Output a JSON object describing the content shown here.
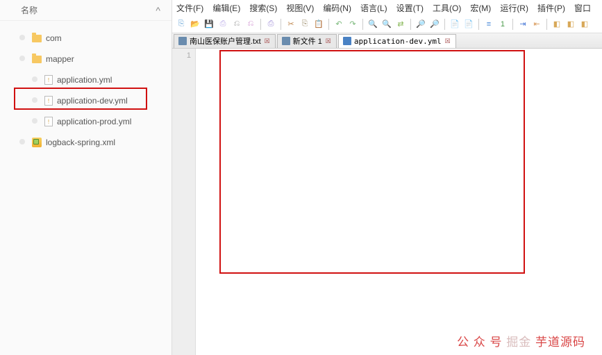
{
  "sidebar": {
    "header": {
      "name_col": "名称",
      "chev": "^"
    },
    "items": [
      {
        "label": "com",
        "icon": "folder",
        "indent": 1
      },
      {
        "label": "mapper",
        "icon": "folder",
        "indent": 1
      },
      {
        "label": "application.yml",
        "icon": "file",
        "indent": 2,
        "glyph": "!"
      },
      {
        "label": "application-dev.yml",
        "icon": "file",
        "indent": 2,
        "glyph": "!",
        "selected": true
      },
      {
        "label": "application-prod.yml",
        "icon": "file",
        "indent": 2,
        "glyph": "!"
      },
      {
        "label": "logback-spring.xml",
        "icon": "xml",
        "indent": 1
      }
    ]
  },
  "menu": {
    "items": [
      "文件(F)",
      "编辑(E)",
      "搜索(S)",
      "视图(V)",
      "编码(N)",
      "语言(L)",
      "设置(T)",
      "工具(O)",
      "宏(M)",
      "运行(R)",
      "插件(P)",
      "窗口"
    ]
  },
  "toolbar": {
    "groups": [
      [
        {
          "c": "#6aa6d8",
          "g": "⎘"
        },
        {
          "c": "#d8d058",
          "g": "📂"
        },
        {
          "c": "#7a7ae8",
          "g": "💾"
        },
        {
          "c": "#b8a8e8",
          "g": "⎙"
        },
        {
          "c": "#a0a0a0",
          "g": "⎌"
        },
        {
          "c": "#d090d0",
          "g": "⎌"
        }
      ],
      [
        {
          "c": "#a090d8",
          "g": "⎙"
        }
      ],
      [
        {
          "c": "#c08850",
          "g": "✂"
        },
        {
          "c": "#a09070",
          "g": "⎘"
        },
        {
          "c": "#a09070",
          "g": "📋"
        }
      ],
      [
        {
          "c": "#7ab87a",
          "g": "↶"
        },
        {
          "c": "#7ab87a",
          "g": "↷"
        }
      ],
      [
        {
          "c": "#6aa6d8",
          "g": "🔍"
        },
        {
          "c": "#88b858",
          "g": "🔍"
        },
        {
          "c": "#88b858",
          "g": "⇄"
        }
      ],
      [
        {
          "c": "#8a9ac8",
          "g": "🔎"
        },
        {
          "c": "#8a9ac8",
          "g": "🔎"
        }
      ],
      [
        {
          "c": "#e0a850",
          "g": "📄"
        },
        {
          "c": "#e0a850",
          "g": "📄"
        }
      ],
      [
        {
          "c": "#4a8ad8",
          "g": "≡"
        },
        {
          "c": "#4a9a4a",
          "g": "1"
        }
      ],
      [
        {
          "c": "#4a7ad8",
          "g": "⇥"
        },
        {
          "c": "#d89858",
          "g": "⇤"
        }
      ],
      [
        {
          "c": "#d8a858",
          "g": "◧"
        },
        {
          "c": "#d8a858",
          "g": "◧"
        },
        {
          "c": "#d8a858",
          "g": "◧"
        }
      ]
    ]
  },
  "tabs": [
    {
      "label": "南山医保账户管理.txt",
      "suffix": "☒",
      "active": false
    },
    {
      "label": "新文件 1",
      "suffix": "☒",
      "active": false
    },
    {
      "label": "application-dev.yml",
      "suffix": "☒",
      "active": true,
      "monospace": true
    }
  ],
  "editor": {
    "first_line_no": "1"
  },
  "watermark": {
    "a": "公 众 号",
    "b": "掘金",
    "c": "芋道源码"
  }
}
